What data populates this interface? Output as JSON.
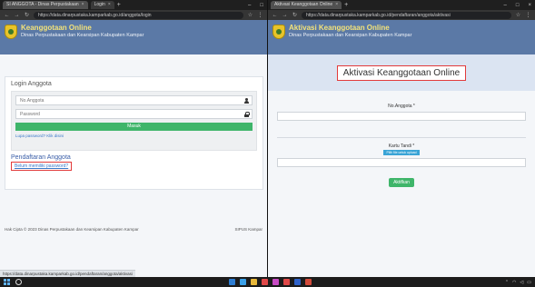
{
  "left_window": {
    "tab_title": "SI ANGGOTA - Dinas Perpustakaan",
    "tab2_title": "Login",
    "url": "https://data.dinarpustaka.kamparkab.go.id/anggota/login",
    "header": {
      "title": "Keanggotaan Online",
      "subtitle": "Dinas Perpustakaan dan Kearsipan Kabupaten Kampar"
    },
    "login": {
      "heading": "Login Anggota",
      "member_placeholder": "No.Anggota",
      "password_placeholder": "Password",
      "submit_label": "Masuk",
      "forgot_label": "Lupa password? Klik disini"
    },
    "registration": {
      "heading": "Pendaftaran Anggota",
      "link_label": "Belum memiliki password?"
    },
    "footer": {
      "left": "Hak Cipta © 2023 Dinas Perpustakaan dan Kearsipan Kabupaten Kampar",
      "right": "SIPUS Kampar"
    },
    "status_url": "https://data.dinarpustaka.kamparkab.go.id/pendaftaran/anggota/aktivasi"
  },
  "right_window": {
    "tab_title": "Aktivasi Keanggotaan Online",
    "url": "https://data.dinarpustaka.kamparkab.go.id/pendaftaran/anggota/aktivasi",
    "header": {
      "title": "Aktivasi Keanggotaan Online",
      "subtitle": "Dinas Perpustakaan dan Kearsipan Kabupaten Kampar"
    },
    "banner": "Aktivasi Keanggotaan Online",
    "form": {
      "member_label": "No.Anggota *",
      "file_label": "Kartu Tandi *",
      "choose_label": "Pilih file untuk upload",
      "submit_label": "Aktifkan"
    }
  },
  "colors": {
    "header_blue": "#5b79a6",
    "title_yellow": "#f3e37a",
    "button_green": "#3fb56a",
    "highlight_red": "#e23b3b"
  }
}
